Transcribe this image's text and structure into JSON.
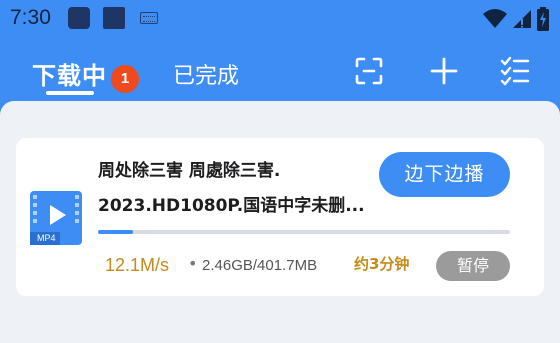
{
  "status_bar": {
    "time": "7:30",
    "icons": [
      "notification-square-icon",
      "notification-square-icon",
      "keyboard-icon",
      "wifi-icon",
      "signal-icon",
      "battery-charging-icon"
    ]
  },
  "tabs": [
    {
      "label": "下载中",
      "active": true,
      "badge": "1"
    },
    {
      "label": "已完成",
      "active": false
    }
  ],
  "toolbar": {
    "icons": [
      "scan-icon",
      "plus-icon",
      "checklist-icon"
    ]
  },
  "colors": {
    "accent": "#3d8df5",
    "badge": "#ee4a1e",
    "speed": "#c58a18",
    "pause": "#9b9b9b"
  },
  "download": {
    "title_line1": "周处除三害 周處除三害.",
    "title_line2": "2023.HD1080P.国语中字未删...",
    "file_type": "MP4",
    "action_label": "边下边播",
    "progress": 0.085,
    "speed": "12.1M/s",
    "separator": "•",
    "sizes": "2.46GB/401.7MB",
    "eta": "约3分钟",
    "pause_label": "暂停"
  }
}
